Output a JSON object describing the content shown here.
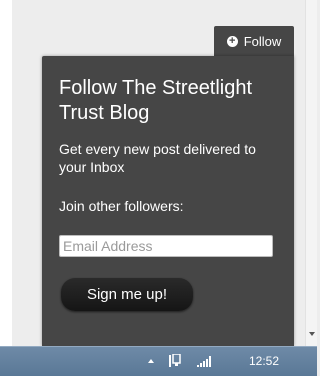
{
  "follow_tab": {
    "icon": "plus-circle-icon",
    "label": "Follow"
  },
  "panel": {
    "title": "Follow The Streetlight Trust Blog",
    "description": "Get every new post delivered to your Inbox",
    "join_text": "Join other followers:",
    "email_placeholder": "Email Address",
    "email_value": "",
    "signup_label": "Sign me up!"
  },
  "taskbar": {
    "tray_icons": [
      "chevron-up-icon",
      "network-icon",
      "signal-bars-icon"
    ],
    "clock": "12:52"
  },
  "colors": {
    "panel_bg": "#464646",
    "taskbar_bg": "#6480a0",
    "page_bg": "#ededed"
  }
}
